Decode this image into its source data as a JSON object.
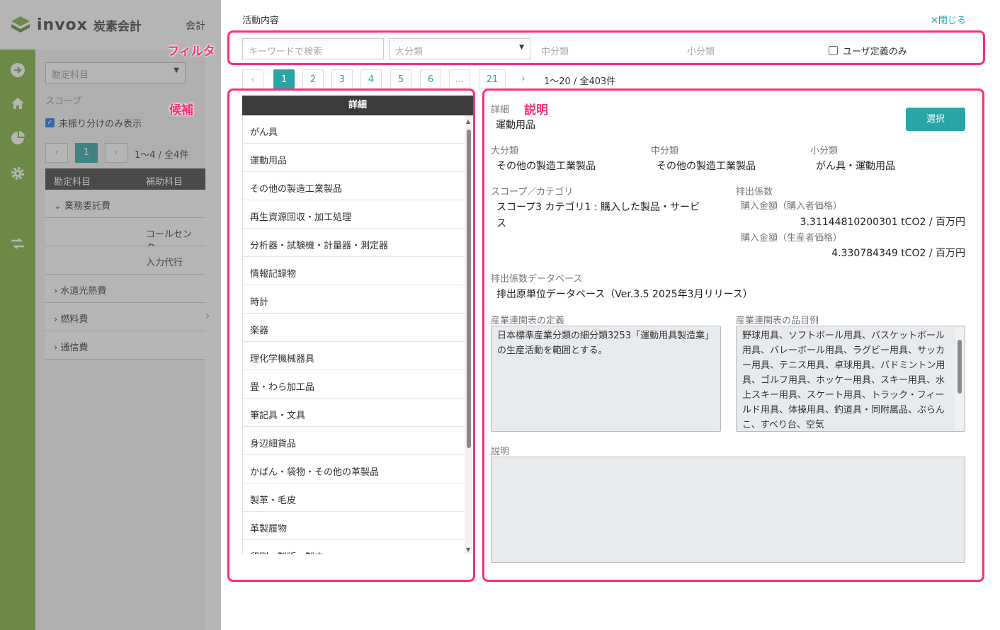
{
  "app": {
    "brand": "invox",
    "brand_sub": "炭素会計",
    "top_menu": "会計"
  },
  "left_panel": {
    "account_select_placeholder": "勘定科目",
    "scope_label": "スコープ",
    "unassigned_only_label": "未振り分けのみ表示",
    "pager_current": "1",
    "pager_info": "1〜4 / 全4件",
    "table_headers": [
      "勘定科目",
      "補助科目"
    ],
    "rows": [
      {
        "label": "業務委託費",
        "expanded": true
      },
      {
        "label": "コールセンタ"
      },
      {
        "label": "入力代行"
      },
      {
        "label": "水道光熱費",
        "expanded": false
      },
      {
        "label": "燃料費",
        "expanded": false
      },
      {
        "label": "通信費",
        "expanded": false
      }
    ]
  },
  "modal": {
    "title": "活動内容",
    "close_label": "閉じる",
    "annotations": {
      "filter": "フィルタ",
      "candidates": "候補",
      "description": "説明"
    },
    "filters": {
      "keyword_placeholder": "キーワードで検索",
      "major_placeholder": "大分類",
      "middle_placeholder": "中分類",
      "minor_placeholder": "小分類",
      "user_defined_only_label": "ユーザ定義のみ"
    },
    "pagination": {
      "pages": [
        "1",
        "2",
        "3",
        "4",
        "5",
        "6",
        "...",
        "21"
      ],
      "current": "1",
      "info": "1〜20 / 全403件"
    },
    "list": {
      "header": "詳細",
      "items": [
        "がん具",
        "運動用品",
        "その他の製造工業製品",
        "再生資源回収・加工処理",
        "分析器・試験機・計量器・測定器",
        "情報記録物",
        "時計",
        "楽器",
        "理化学機械器具",
        "畳・わら加工品",
        "筆記具・文具",
        "身辺細貨品",
        "かばん・袋物・その他の革製品",
        "製革・毛皮",
        "革製履物",
        "印刷・製版・製本"
      ]
    },
    "detail": {
      "detail_label": "詳細",
      "detail_value": "運動用品",
      "select_button": "選択",
      "major_label": "大分類",
      "major_value": "その他の製造工業製品",
      "middle_label": "中分類",
      "middle_value": "その他の製造工業製品",
      "minor_label": "小分類",
      "minor_value": "がん具・運動用品",
      "scope_label": "スコープ／カテゴリ",
      "scope_value_1": "スコープ3 カテゴリ1 : 購入した製品・サービ",
      "scope_value_2": "ス",
      "ef_label": "排出係数",
      "ef_buyer_label": "購入金額（購入者価格）",
      "ef_buyer_value": "3.31144810200301 tCO2 / 百万円",
      "ef_producer_label": "購入金額（生産者価格）",
      "ef_producer_value": "4.330784349 tCO2 / 百万円",
      "db_label": "排出係数データベース",
      "db_value": "排出原単位データベース（Ver.3.5 2025年3月リリース）",
      "io_def_label": "産業連関表の定義",
      "io_def_value": "日本標準産業分類の細分類3253「運動用具製造業」の生産活動を範囲とする。",
      "io_examples_label": "産業連関表の品目例",
      "io_examples_value": "野球用具、ソフトボール用具、バスケットボール用具、バレーボール用具、ラグビー用具、サッカー用具、テニス用具、卓球用具、バドミントン用具、ゴルフ用具、ホッケー用具、スキー用具、水上スキー用具、スケート用具、トラック・フィールド用具、体操用具、釣道具・同附属品、ぶらんこ、すべり台、空気",
      "description_label": "説明",
      "description_value": ""
    }
  },
  "colors": {
    "accent": "#2aa5a5",
    "sidebar": "#7ab03a",
    "highlight": "#ff2d7a",
    "dark_header": "#3c3c3c"
  }
}
